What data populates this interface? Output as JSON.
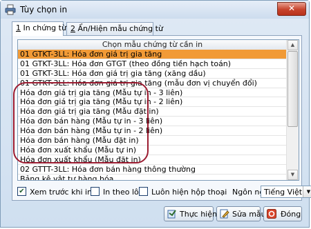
{
  "window": {
    "title": "Tùy chọn in",
    "close_glyph": "✕"
  },
  "tabs": [
    {
      "label_prefix": "1",
      "label": " In chứng từ",
      "active": true
    },
    {
      "label_prefix": "2",
      "label": " Ẩn/Hiện mẫu chứng từ",
      "active": false
    }
  ],
  "list": {
    "header": "Chọn mẫu chứng từ cần in",
    "rows": [
      "01 GTKT-3LL: Hóa đơn giá trị gia tăng",
      "01 GTKT-3LL: Hóa đơn GTGT (theo đồng tiền hạch toán)",
      "01 GTKT-3LL: Hóa đơn giá trị gia tăng (xăng dầu)",
      "01 GTKT-3LL: Hóa đơn giá trị gia tăng (mẫu đơn vị chuyển đổi)",
      "Hóa đơn giá trị gia tăng (Mẫu tự in - 3 liên)",
      "Hóa đơn giá trị gia tăng (Mẫu tự in - 2 liên)",
      "Hóa đơn giá trị gia tăng (Mẫu đặt in)",
      "Hóa đơn bán hàng (Mẫu tự in - 3 liên)",
      "Hóa đơn bán hàng (Mẫu tự in - 2 liên)",
      "Hóa đơn bán hàng (Mẫu đặt in)",
      "Hóa đơn xuất khẩu (Mẫu tự in)",
      "Hóa đơn xuất khẩu (Mẫu đặt in)",
      "02 GTTT-3LL: Hóa đơn bán hàng thông thường",
      "Bảng kê vật tư hàng hóa"
    ],
    "selected_index": 0,
    "selected_color": "#f19a36"
  },
  "options": {
    "preview": {
      "label": "Xem trước khi in",
      "checked": true
    },
    "batch": {
      "label": "In theo lô",
      "checked": false
    },
    "always_show": {
      "label": "Luôn hiện hộp thoại này khi in",
      "checked": false
    },
    "language_label": "Ngôn ngữ",
    "language_value": "Tiếng Việt"
  },
  "buttons": {
    "execute": "Thực hiện",
    "edit_template": "Sửa mẫu",
    "close": "Đóng"
  },
  "colors": {
    "highlight_ellipse": "#9b1b30",
    "close_button": "#c7432c"
  }
}
